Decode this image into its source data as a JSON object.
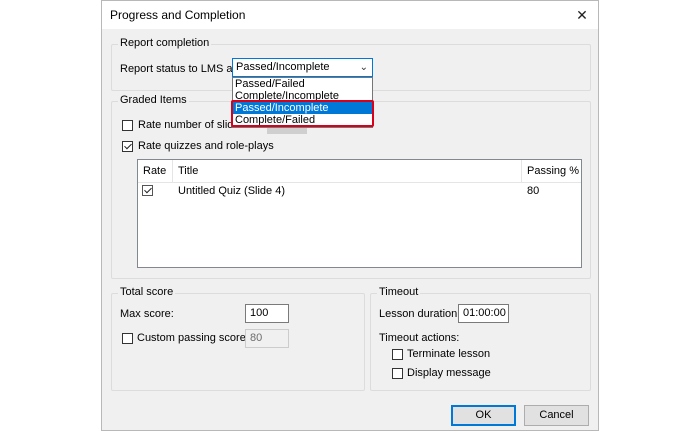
{
  "dialog": {
    "title": "Progress and Completion",
    "close_glyph": "✕"
  },
  "report_completion": {
    "group_label": "Report completion",
    "status_label": "Report status to LMS as:",
    "selected_value": "Passed/Incomplete",
    "options": [
      "Passed/Failed",
      "Complete/Incomplete",
      "Passed/Incomplete",
      "Complete/Failed"
    ],
    "highlighted_options": [
      "Passed/Incomplete",
      "Complete/Failed"
    ],
    "arrow_icon": "chevron-down-icon"
  },
  "graded_items": {
    "group_label": "Graded Items",
    "rate_slides_label": "Rate number of slides viewed",
    "rate_slides_checked": false,
    "rate_quizzes_label": "Rate quizzes and role-plays",
    "rate_quizzes_checked": true,
    "table": {
      "columns": [
        "Rate",
        "Title",
        "Passing %"
      ],
      "rows": [
        {
          "rate_checked": true,
          "title": "Untitled Quiz (Slide 4)",
          "passing": "80"
        }
      ]
    }
  },
  "total_score": {
    "group_label": "Total score",
    "max_score_label": "Max score:",
    "max_score_value": "100",
    "custom_passing_label": "Custom passing score:",
    "custom_passing_checked": false,
    "custom_passing_value": "80"
  },
  "timeout": {
    "group_label": "Timeout",
    "lesson_duration_label": "Lesson duration:",
    "lesson_duration_value": "01:00:00",
    "actions_label": "Timeout actions:",
    "terminate_label": "Terminate lesson",
    "terminate_checked": false,
    "display_message_label": "Display message",
    "display_message_checked": false
  },
  "buttons": {
    "ok": "OK",
    "cancel": "Cancel"
  },
  "colors": {
    "accent": "#0078d7",
    "highlight": "#d9001b"
  }
}
